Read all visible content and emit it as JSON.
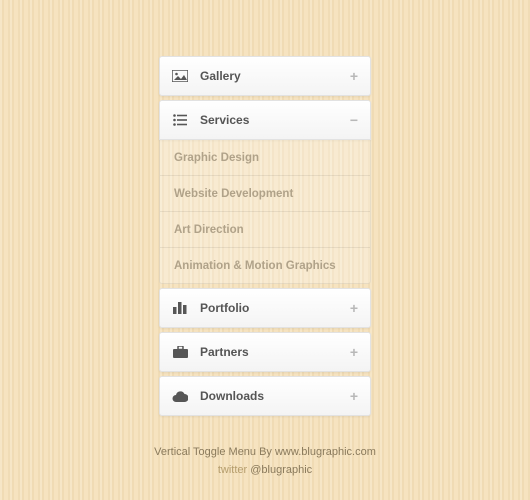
{
  "menu": [
    {
      "label": "Gallery",
      "icon": "image-icon",
      "expanded": false,
      "children": []
    },
    {
      "label": "Services",
      "icon": "list-icon",
      "expanded": true,
      "children": [
        "Graphic Design",
        "Website Development",
        "Art Direction",
        "Animation & Motion Graphics"
      ]
    },
    {
      "label": "Portfolio",
      "icon": "chart-icon",
      "expanded": false,
      "children": []
    },
    {
      "label": "Partners",
      "icon": "briefcase-icon",
      "expanded": false,
      "children": []
    },
    {
      "label": "Downloads",
      "icon": "cloud-icon",
      "expanded": false,
      "children": []
    }
  ],
  "toggle": {
    "plus": "+",
    "minus": "−"
  },
  "footer": {
    "line1": "Vertical Toggle Menu By www.blugraphic.com",
    "twitter_label": "twitter",
    "twitter_handle": "@blugraphic"
  }
}
